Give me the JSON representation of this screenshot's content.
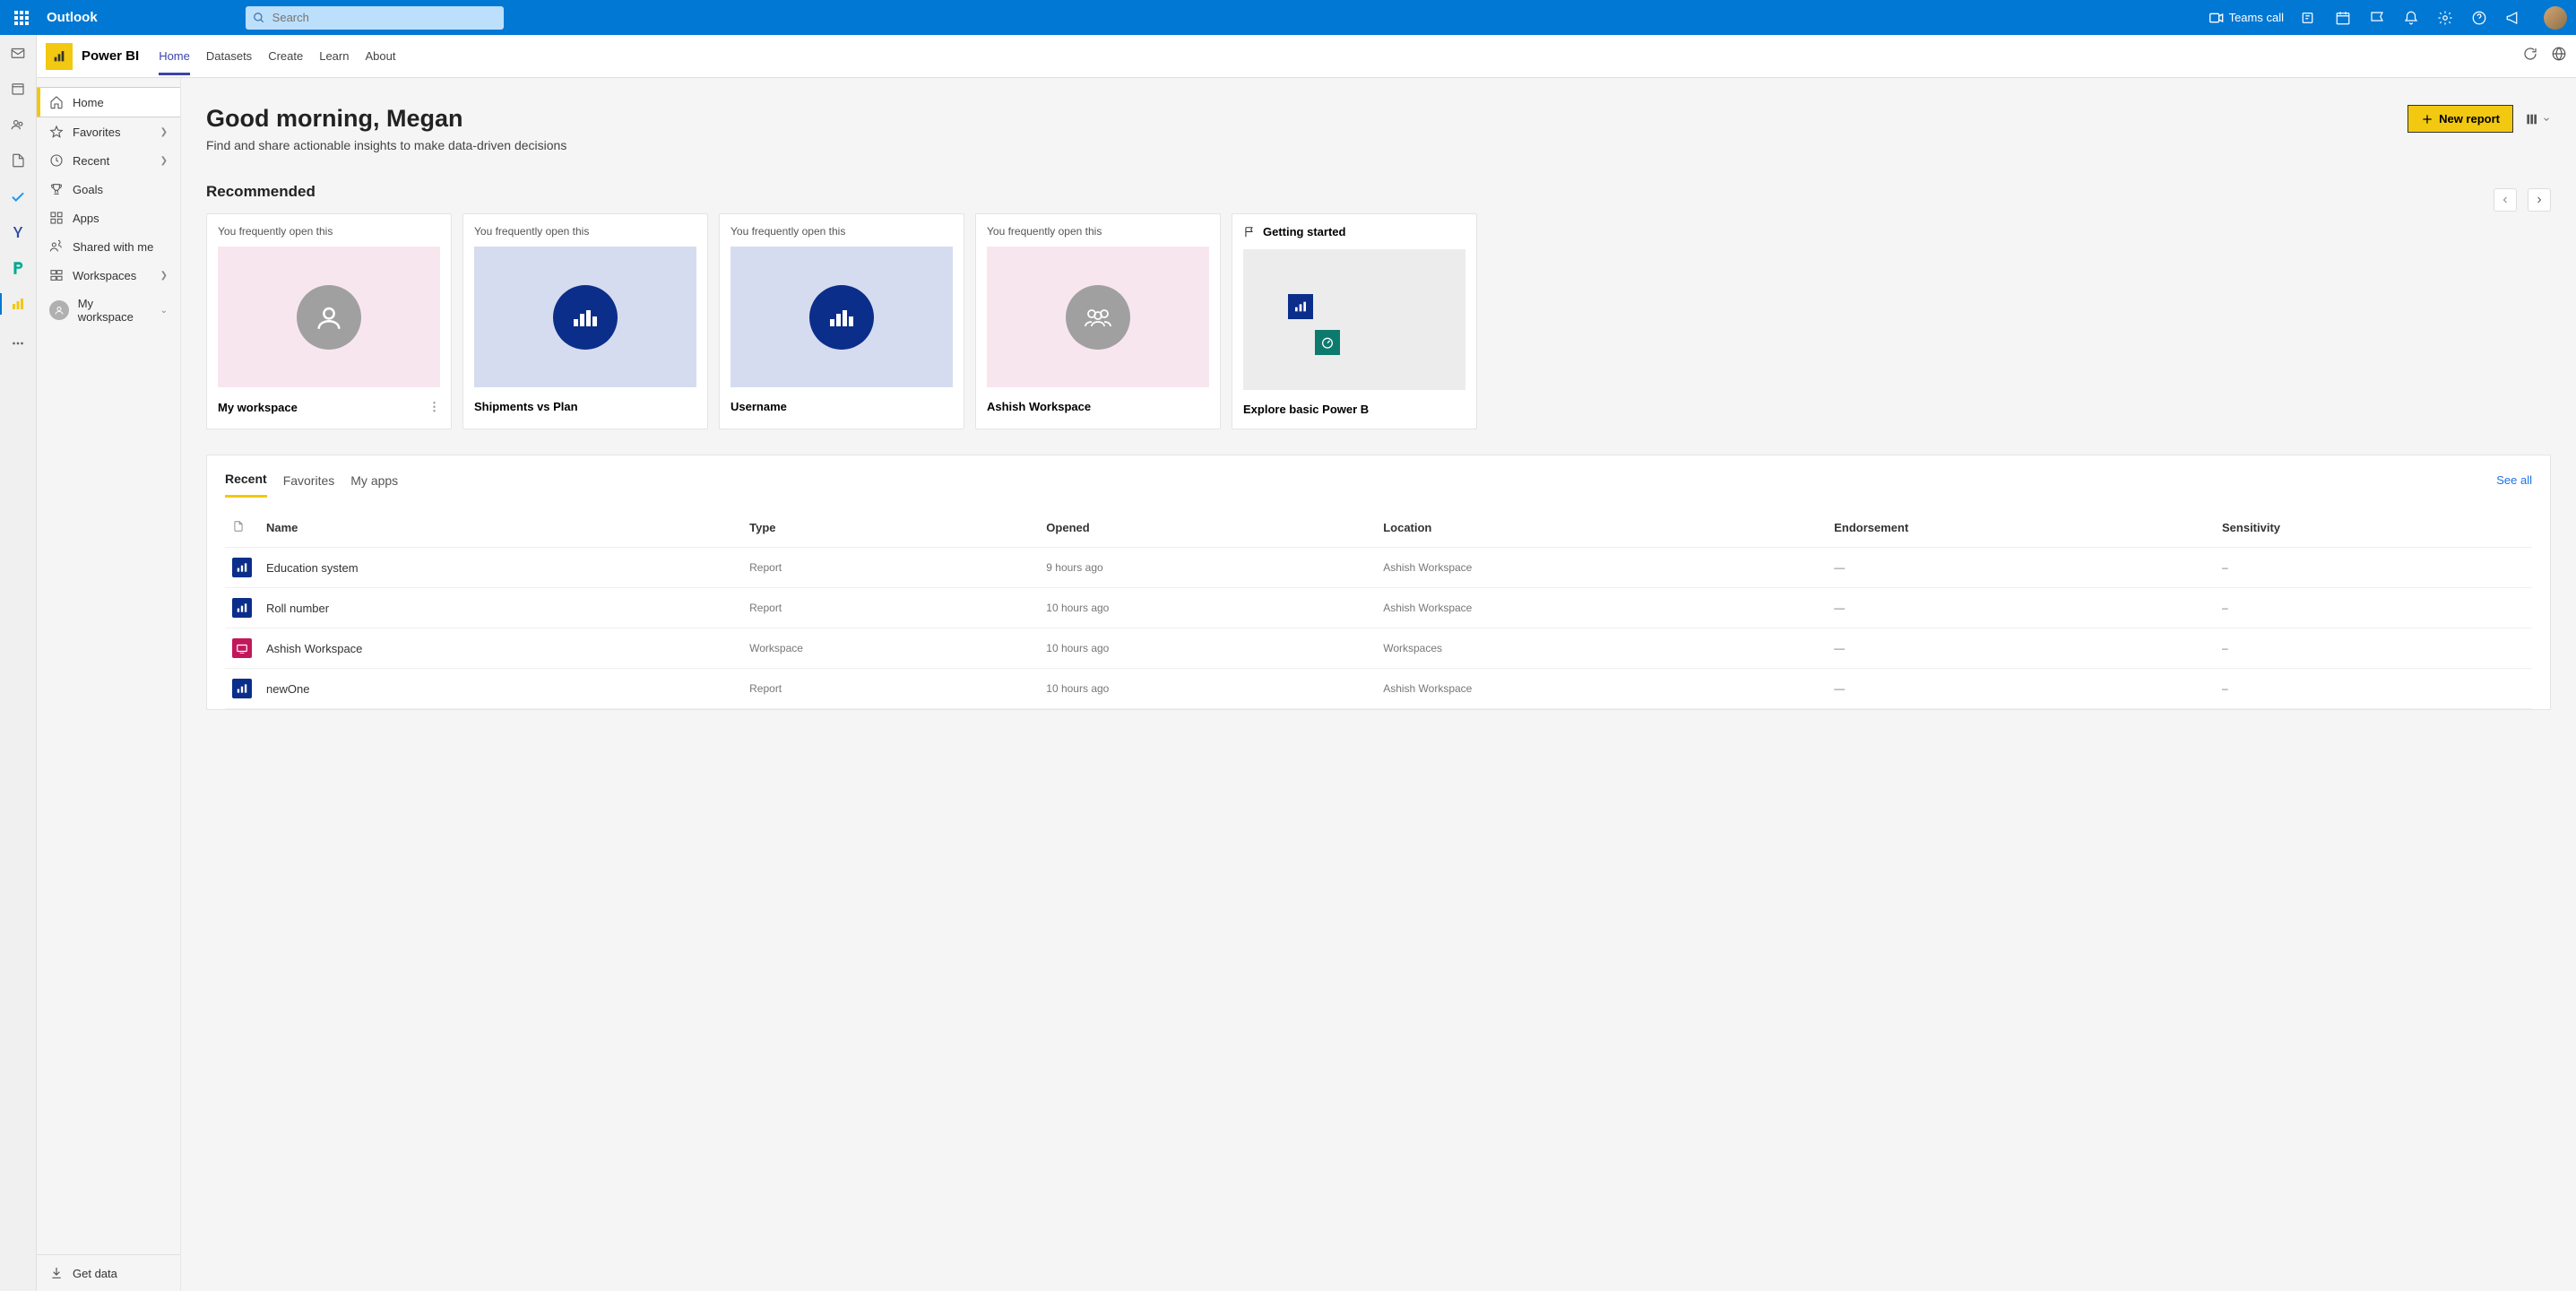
{
  "header": {
    "app_name": "Outlook",
    "search_placeholder": "Search",
    "teams_call": "Teams call"
  },
  "pbi": {
    "title": "Power BI",
    "tabs": [
      "Home",
      "Datasets",
      "Create",
      "Learn",
      "About"
    ],
    "active_tab": 0
  },
  "sidebar": {
    "items": [
      {
        "label": "Home",
        "icon": "home",
        "active": true
      },
      {
        "label": "Favorites",
        "icon": "star",
        "arrow": true
      },
      {
        "label": "Recent",
        "icon": "clock",
        "arrow": true
      },
      {
        "label": "Goals",
        "icon": "trophy"
      },
      {
        "label": "Apps",
        "icon": "apps"
      },
      {
        "label": "Shared with me",
        "icon": "share"
      },
      {
        "label": "Workspaces",
        "icon": "workspaces",
        "arrow": true
      },
      {
        "label": "My workspace",
        "icon": "myworkspace",
        "arrow_down": true
      }
    ],
    "get_data": "Get data"
  },
  "greeting": {
    "title": "Good morning, Megan",
    "subtitle": "Find and share actionable insights to make data-driven decisions",
    "new_report": "New report"
  },
  "recommended": {
    "title": "Recommended",
    "cards": [
      {
        "label": "You frequently open this",
        "title": "My workspace",
        "thumb": "pink",
        "circle": "grey",
        "icon": "user",
        "more": true
      },
      {
        "label": "You frequently open this",
        "title": "Shipments vs Plan",
        "thumb": "blue",
        "circle": "navy",
        "icon": "bars"
      },
      {
        "label": "You frequently open this",
        "title": "Username",
        "thumb": "blue",
        "circle": "navy",
        "icon": "bars"
      },
      {
        "label": "You frequently open this",
        "title": "Ashish Workspace",
        "thumb": "pink",
        "circle": "grey",
        "icon": "people"
      },
      {
        "label": "",
        "title": "Explore basic Power B",
        "thumb": "grey",
        "getting_started": "Getting started"
      }
    ]
  },
  "content_tabs": {
    "tabs": [
      "Recent",
      "Favorites",
      "My apps"
    ],
    "active": 0,
    "see_all": "See all"
  },
  "table": {
    "columns": [
      "",
      "Name",
      "Type",
      "Opened",
      "Location",
      "Endorsement",
      "Sensitivity"
    ],
    "rows": [
      {
        "icon": "report",
        "name": "Education system",
        "type": "Report",
        "opened": "9 hours ago",
        "location": "Ashish Workspace",
        "endorsement": "—",
        "sensitivity": "–"
      },
      {
        "icon": "report",
        "name": "Roll number",
        "type": "Report",
        "opened": "10 hours ago",
        "location": "Ashish Workspace",
        "endorsement": "—",
        "sensitivity": "–"
      },
      {
        "icon": "workspace",
        "name": "Ashish Workspace",
        "type": "Workspace",
        "opened": "10 hours ago",
        "location": "Workspaces",
        "endorsement": "—",
        "sensitivity": "–"
      },
      {
        "icon": "report",
        "name": "newOne",
        "type": "Report",
        "opened": "10 hours ago",
        "location": "Ashish Workspace",
        "endorsement": "—",
        "sensitivity": "–"
      }
    ]
  }
}
